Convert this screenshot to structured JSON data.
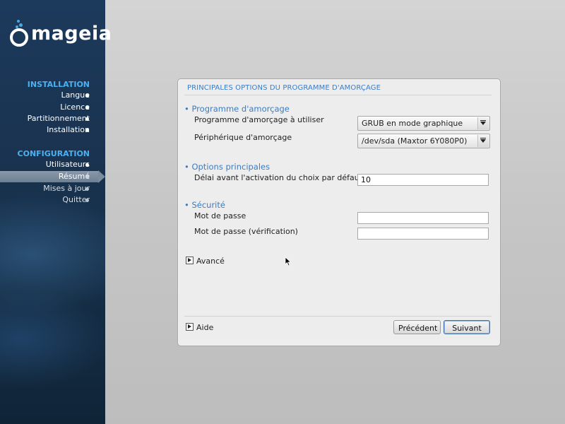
{
  "brand": {
    "name": "mageia"
  },
  "sidebar": {
    "sections": [
      {
        "title": "INSTALLATION",
        "items": [
          {
            "label": "Langue",
            "state": "done"
          },
          {
            "label": "Licence",
            "state": "done"
          },
          {
            "label": "Partitionnement",
            "state": "done"
          },
          {
            "label": "Installation",
            "state": "done"
          }
        ]
      },
      {
        "title": "CONFIGURATION",
        "items": [
          {
            "label": "Utilisateurs",
            "state": "done"
          },
          {
            "label": "Résumé",
            "state": "active"
          },
          {
            "label": "Mises à jour",
            "state": "pending"
          },
          {
            "label": "Quitter",
            "state": "pending"
          }
        ]
      }
    ]
  },
  "dialog": {
    "title": "PRINCIPALES OPTIONS DU PROGRAMME D'AMORÇAGE",
    "groups": {
      "bootloader": {
        "title": "Programme d'amorçage",
        "loader_label": "Programme d'amorçage à utiliser",
        "loader_value": "GRUB en mode graphique",
        "device_label": "Périphérique d'amorçage",
        "device_value": "/dev/sda (Maxtor 6Y080P0)"
      },
      "main_options": {
        "title": "Options principales",
        "delay_label": "Délai avant l'activation du choix par défaut",
        "delay_value": "10"
      },
      "security": {
        "title": "Sécurité",
        "password_label": "Mot de passe",
        "password_value": "",
        "password_verify_label": "Mot de passe (vérification)",
        "password_verify_value": ""
      }
    },
    "advanced_label": "Avancé",
    "help_label": "Aide",
    "buttons": {
      "previous": "Précédent",
      "next": "Suivant"
    }
  },
  "colors": {
    "accent": "#3c7cc4",
    "sidebar_section": "#4db0f0",
    "sidebar_bg": "#1a3452"
  }
}
